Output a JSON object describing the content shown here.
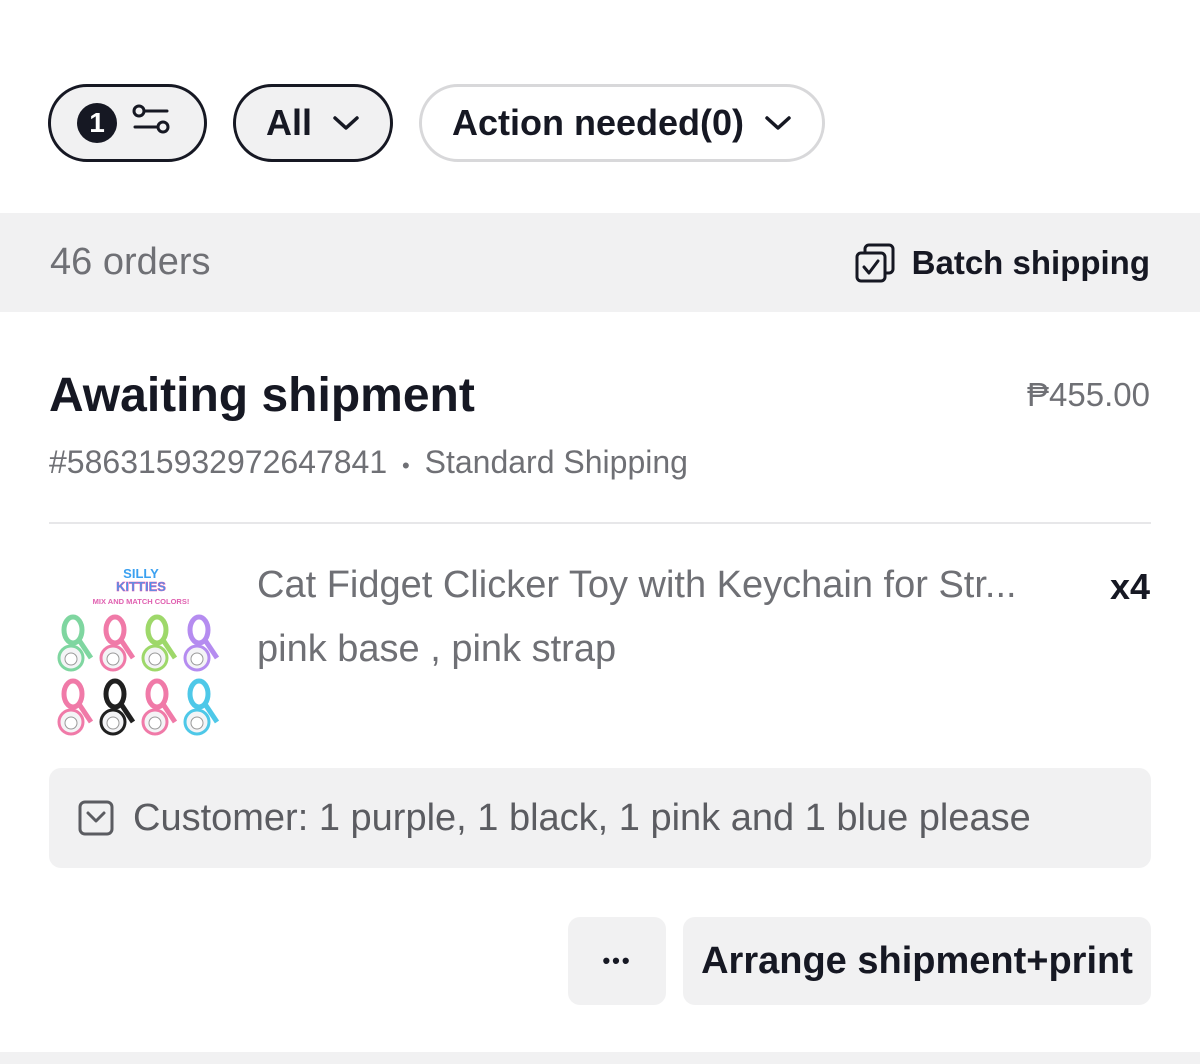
{
  "filters": {
    "active_count": "1",
    "filter_icon": "sliders-icon",
    "type_label": "All",
    "status_label": "Action needed(0)"
  },
  "summary": {
    "orders_count": "46 orders",
    "batch_label": "Batch shipping"
  },
  "order": {
    "status": "Awaiting shipment",
    "price": "₱455.00",
    "order_id": "#586315932972647841",
    "separator": "•",
    "shipping_method": "Standard Shipping",
    "product": {
      "name": "Cat Fidget Clicker Toy with Keychain for Str...",
      "variant": "pink base , pink strap",
      "quantity": "x4",
      "thumb_title": "SILLY KITTIES",
      "thumb_subtitle": "MIX AND MATCH COLORS!"
    },
    "customer_note": "Customer: 1 purple, 1 black, 1 pink and 1 blue please",
    "more_label": "•••",
    "primary_action": "Arrange shipment+print"
  },
  "colors": {
    "text": "#161823",
    "muted": "#6f7075",
    "surface": "#f1f1f2"
  }
}
